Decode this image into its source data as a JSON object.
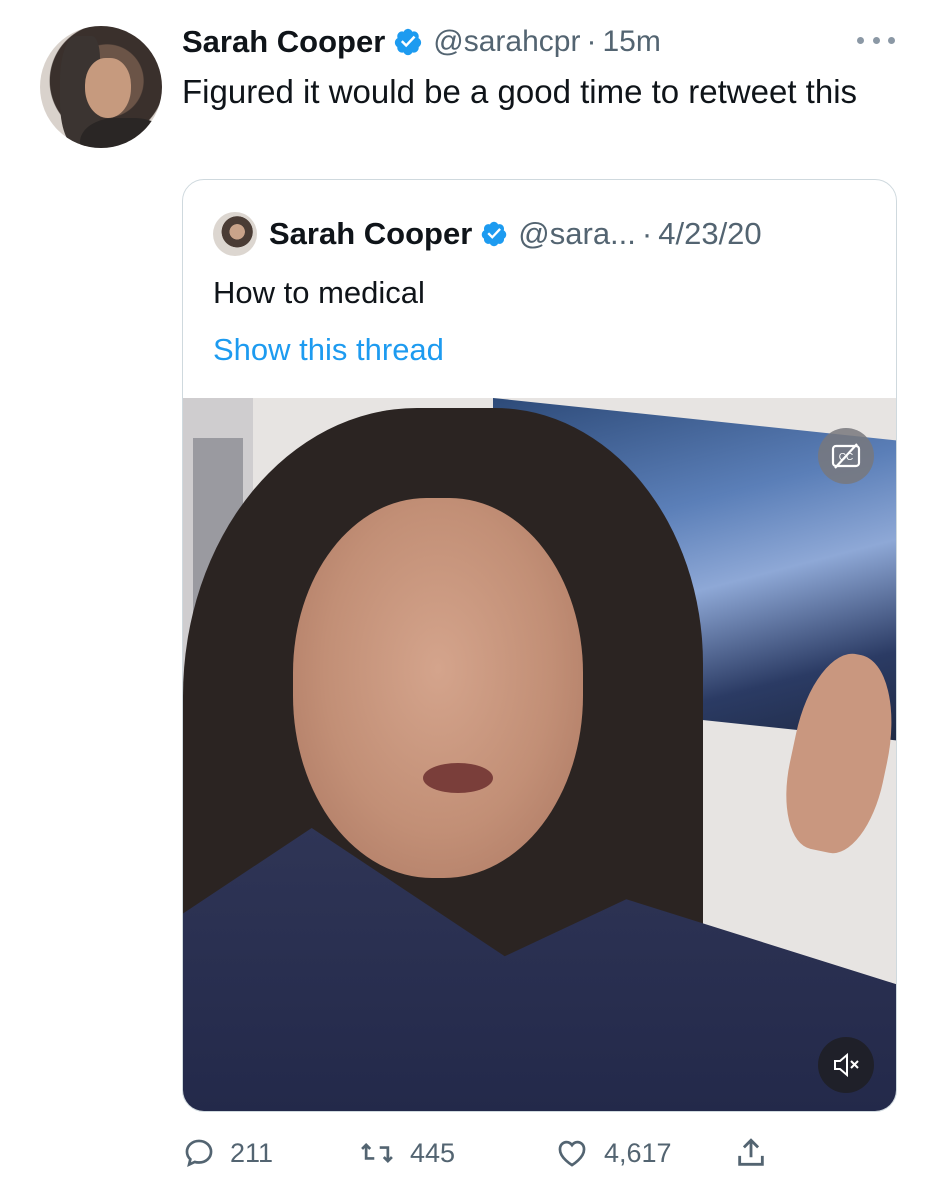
{
  "tweet": {
    "author_name": "Sarah Cooper",
    "author_handle": "@sarahcpr",
    "separator": "·",
    "time": "15m",
    "text": "Figured it would be a good time to retweet this"
  },
  "quoted": {
    "author_name": "Sarah Cooper",
    "author_handle": "@sara...",
    "separator": "·",
    "date": "4/23/20",
    "text": "How to medical",
    "thread_link": "Show this thread"
  },
  "video": {
    "captions_icon": "closed-captions-off-icon",
    "mute_icon": "volume-muted-icon"
  },
  "actions": {
    "replies": "211",
    "retweets": "445",
    "likes": "4,617"
  },
  "colors": {
    "accent": "#1d9bf0",
    "muted_text": "#536471",
    "border": "#cfd9de"
  }
}
